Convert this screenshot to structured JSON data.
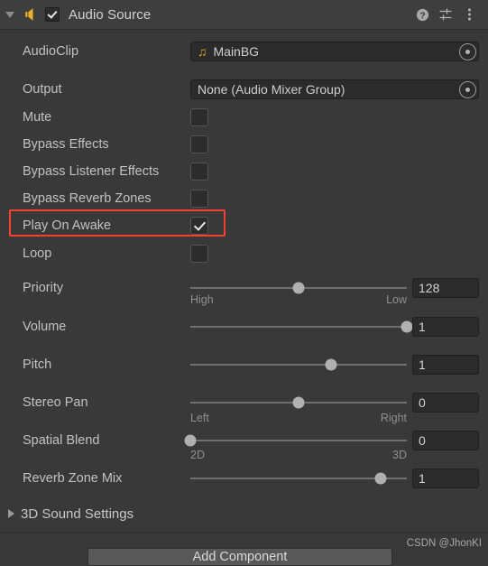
{
  "header": {
    "title": "Audio Source",
    "enabled_checkbox": true,
    "foldout_open": true,
    "icons": {
      "component": "audio-speaker-icon",
      "help": "help-icon",
      "preset": "preset-settings-icon",
      "menu": "more-options-icon"
    }
  },
  "fields": {
    "audio_clip": {
      "label": "AudioClip",
      "value": "MainBG",
      "icon": "music-note-icon",
      "picker": "object-picker-icon"
    },
    "output": {
      "label": "Output",
      "value": "None (Audio Mixer Group)",
      "picker": "object-picker-icon"
    }
  },
  "toggles": [
    {
      "label": "Mute",
      "checked": false
    },
    {
      "label": "Bypass Effects",
      "checked": false
    },
    {
      "label": "Bypass Listener Effects",
      "checked": false
    },
    {
      "label": "Bypass Reverb Zones",
      "checked": false
    },
    {
      "label": "Play On Awake",
      "checked": true,
      "highlighted": true
    },
    {
      "label": "Loop",
      "checked": false
    }
  ],
  "sliders": [
    {
      "label": "Priority",
      "value": "128",
      "fill": 0.5,
      "min_label": "High",
      "max_label": "Low",
      "has_end_labels": true
    },
    {
      "label": "Volume",
      "value": "1",
      "fill": 1.0,
      "min_label": "",
      "max_label": "",
      "has_end_labels": false
    },
    {
      "label": "Pitch",
      "value": "1",
      "fill": 0.65,
      "min_label": "",
      "max_label": "",
      "has_end_labels": false
    },
    {
      "label": "Stereo Pan",
      "value": "0",
      "fill": 0.5,
      "min_label": "Left",
      "max_label": "Right",
      "has_end_labels": true
    },
    {
      "label": "Spatial Blend",
      "value": "0",
      "fill": 0.0,
      "min_label": "2D",
      "max_label": "3D",
      "has_end_labels": true
    },
    {
      "label": "Reverb Zone Mix",
      "value": "1",
      "fill": 0.88,
      "min_label": "",
      "max_label": "",
      "has_end_labels": false
    }
  ],
  "foldout": {
    "label": "3D Sound Settings",
    "expanded": false
  },
  "bottom": {
    "add_component_label": "Add Component",
    "watermark": "CSDN @JhonKI"
  },
  "colors": {
    "panel_bg": "#393939",
    "header_bg": "#3e3e3e",
    "field_bg": "#2b2b2b",
    "accent_yellow": "#e0a61e",
    "highlight_red": "#f43f33",
    "text": "#c2c2c2"
  }
}
